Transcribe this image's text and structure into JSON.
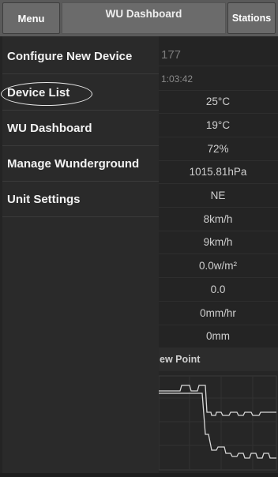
{
  "header": {
    "menu_label": "Menu",
    "title": "WU Dashboard",
    "stations_label": "Stations"
  },
  "drawer": {
    "items": [
      {
        "label": "Configure New Device"
      },
      {
        "label": "Device List"
      },
      {
        "label": "WU Dashboard"
      },
      {
        "label": "Manage Wunderground"
      },
      {
        "label": "Unit Settings"
      }
    ]
  },
  "dashboard": {
    "station_id_partial": "177",
    "time_partial": "1:03:42",
    "values": [
      "25°C",
      "19°C",
      "72%",
      "1015.81hPa",
      "NE",
      "8km/h",
      "9km/h",
      "0.0w/m²",
      "0.0",
      "0mm/hr",
      "0mm"
    ],
    "chart_title_partial": "ew Point"
  },
  "colors": {
    "header_bg": "#5a5a5a",
    "drawer_bg": "#2a2a2a",
    "page_bg": "#242424"
  }
}
